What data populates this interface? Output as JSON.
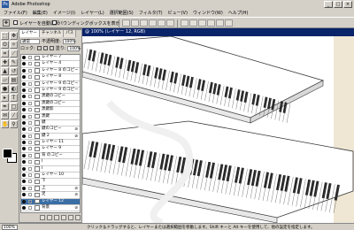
{
  "window": {
    "title": "Adobe Photoshop",
    "icon": "photoshop-app-icon"
  },
  "menu": [
    "ファイル(F)",
    "編集(E)",
    "イメージ(I)",
    "レイヤー(L)",
    "選択範囲(S)",
    "フィルタ(T)",
    "ビュー(V)",
    "ウィンドウ(W)",
    "ヘルプ(H)"
  ],
  "options": {
    "auto_select": "レイヤーを自動選択",
    "bbox": "バウンディングボックスを表示"
  },
  "document": {
    "title": "@ 100% (レイヤー 12, RGB)"
  },
  "layers_panel": {
    "tabs": [
      "レイヤー",
      "チャンネル",
      "パス"
    ],
    "blend_mode": "通常",
    "opacity_label": "不透明度:",
    "opacity_value": "100%",
    "lock_label": "ロック:",
    "fill_label": "塗り:",
    "fill_value": "100%",
    "rows": [
      {
        "name": "レイヤー 7"
      },
      {
        "name": "レイヤー 4"
      },
      {
        "name": "レイヤー 8 のコピー"
      },
      {
        "name": "レイヤー 8"
      },
      {
        "name": "レイヤー 9 のコピー"
      },
      {
        "name": "レイヤー 9 のコピー"
      },
      {
        "name": "黒鍵のコピー"
      },
      {
        "name": "黒鍵のコピー"
      },
      {
        "name": "黒鍵影"
      },
      {
        "name": "黒鍵"
      },
      {
        "name": "鍵"
      },
      {
        "name": "鍵のコピー",
        "badge": "⊘"
      },
      {
        "name": "鍵 2",
        "badge": "⊘"
      },
      {
        "name": "レイヤー 11"
      },
      {
        "name": "レイヤー 9"
      },
      {
        "name": "背 のコピー"
      },
      {
        "name": "I"
      },
      {
        "name": "I"
      },
      {
        "name": "レイヤー 10"
      },
      {
        "name": "下"
      },
      {
        "name": "上",
        "badge": "⊘"
      },
      {
        "name": "足",
        "badge": "⊘"
      },
      {
        "name": "レイヤー 12",
        "selected": true
      },
      {
        "name": "背景",
        "badge": "⊘"
      }
    ]
  },
  "status": {
    "zoom": "100%",
    "message": "クリック＆ドラッグすると、レイヤーまたは選択範囲を移動します。Shift キーと Alt キーを使用して、他の設定を指定します。"
  },
  "colors": {
    "title_bar": "#0a246a",
    "selected_row": "#3a6ea5",
    "chrome": "#d4d0c8"
  }
}
